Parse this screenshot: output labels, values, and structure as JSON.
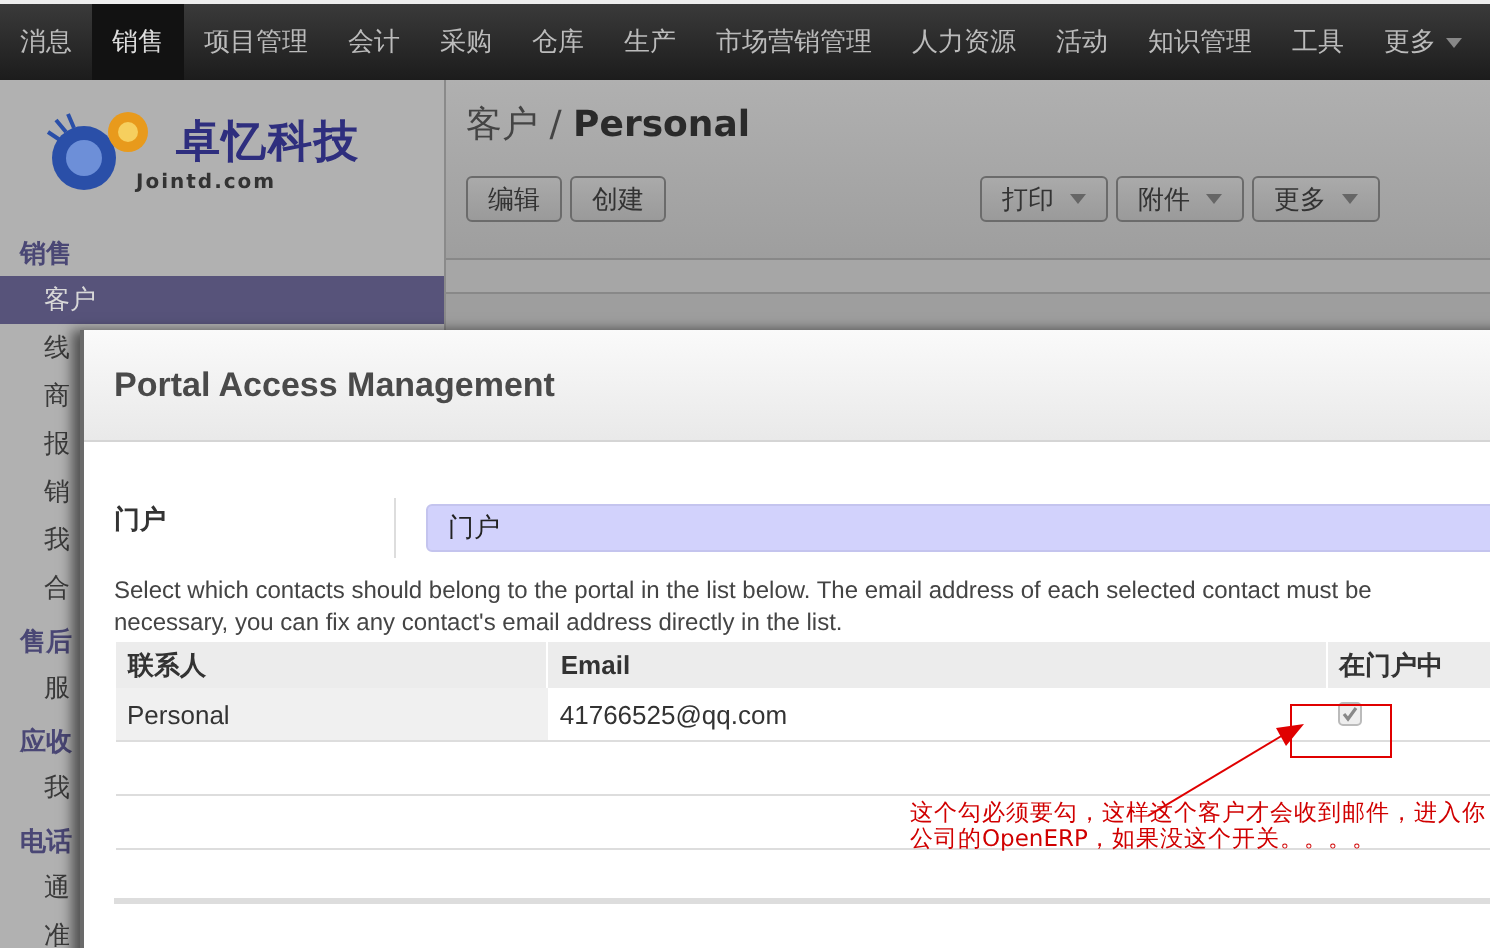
{
  "top_menu": [
    {
      "label": "消息",
      "selected": false
    },
    {
      "label": "销售",
      "selected": true
    },
    {
      "label": "项目管理",
      "selected": false
    },
    {
      "label": "会计",
      "selected": false
    },
    {
      "label": "采购",
      "selected": false
    },
    {
      "label": "仓库",
      "selected": false
    },
    {
      "label": "生产",
      "selected": false
    },
    {
      "label": "市场营销管理",
      "selected": false
    },
    {
      "label": "人力资源",
      "selected": false
    },
    {
      "label": "活动",
      "selected": false
    },
    {
      "label": "知识管理",
      "selected": false
    },
    {
      "label": "工具",
      "selected": false
    },
    {
      "label": "更多",
      "selected": false,
      "kind": "dropdown"
    }
  ],
  "logo": {
    "name": "卓忆科技",
    "domain": "Jointd.com"
  },
  "sidebar": [
    {
      "section": "销售",
      "items": [
        {
          "label": "客户",
          "selected": true
        },
        {
          "label": "线",
          "selected": false
        },
        {
          "label": "商",
          "selected": false
        },
        {
          "label": "报",
          "selected": false
        },
        {
          "label": "销",
          "selected": false
        },
        {
          "label": "我",
          "selected": false
        },
        {
          "label": "合",
          "selected": false
        }
      ]
    },
    {
      "section": "售后",
      "items": [
        {
          "label": "服",
          "selected": false
        }
      ]
    },
    {
      "section": "应收",
      "items": [
        {
          "label": "我",
          "selected": false
        }
      ]
    },
    {
      "section": "电话",
      "items": [
        {
          "label": "通",
          "selected": false
        },
        {
          "label": "准",
          "selected": false
        }
      ]
    }
  ],
  "breadcrumb": {
    "parent": "客户",
    "separator": "/",
    "current": "Personal"
  },
  "buttons_left": [
    "编辑",
    "创建"
  ],
  "buttons_right": [
    "打印",
    "附件",
    "更多"
  ],
  "dialog": {
    "title": "Portal Access Management",
    "portal_label": "门户",
    "portal_value": "门户",
    "description": "Select which contacts should belong to the portal in the list below. The email address of each selected contact must be necessary, you can fix any contact's email address directly in the list.",
    "columns": [
      "联系人",
      "Email",
      "在门户中"
    ],
    "rows": [
      {
        "contact": "Personal",
        "email": "41766525@qq.com",
        "in_portal": true
      }
    ]
  },
  "annotation": {
    "lines": [
      "这个勾必须要勾，这样这个客户才会收到邮件，进入你",
      "公司的OpenERP，如果没这个开关。。。。"
    ]
  }
}
